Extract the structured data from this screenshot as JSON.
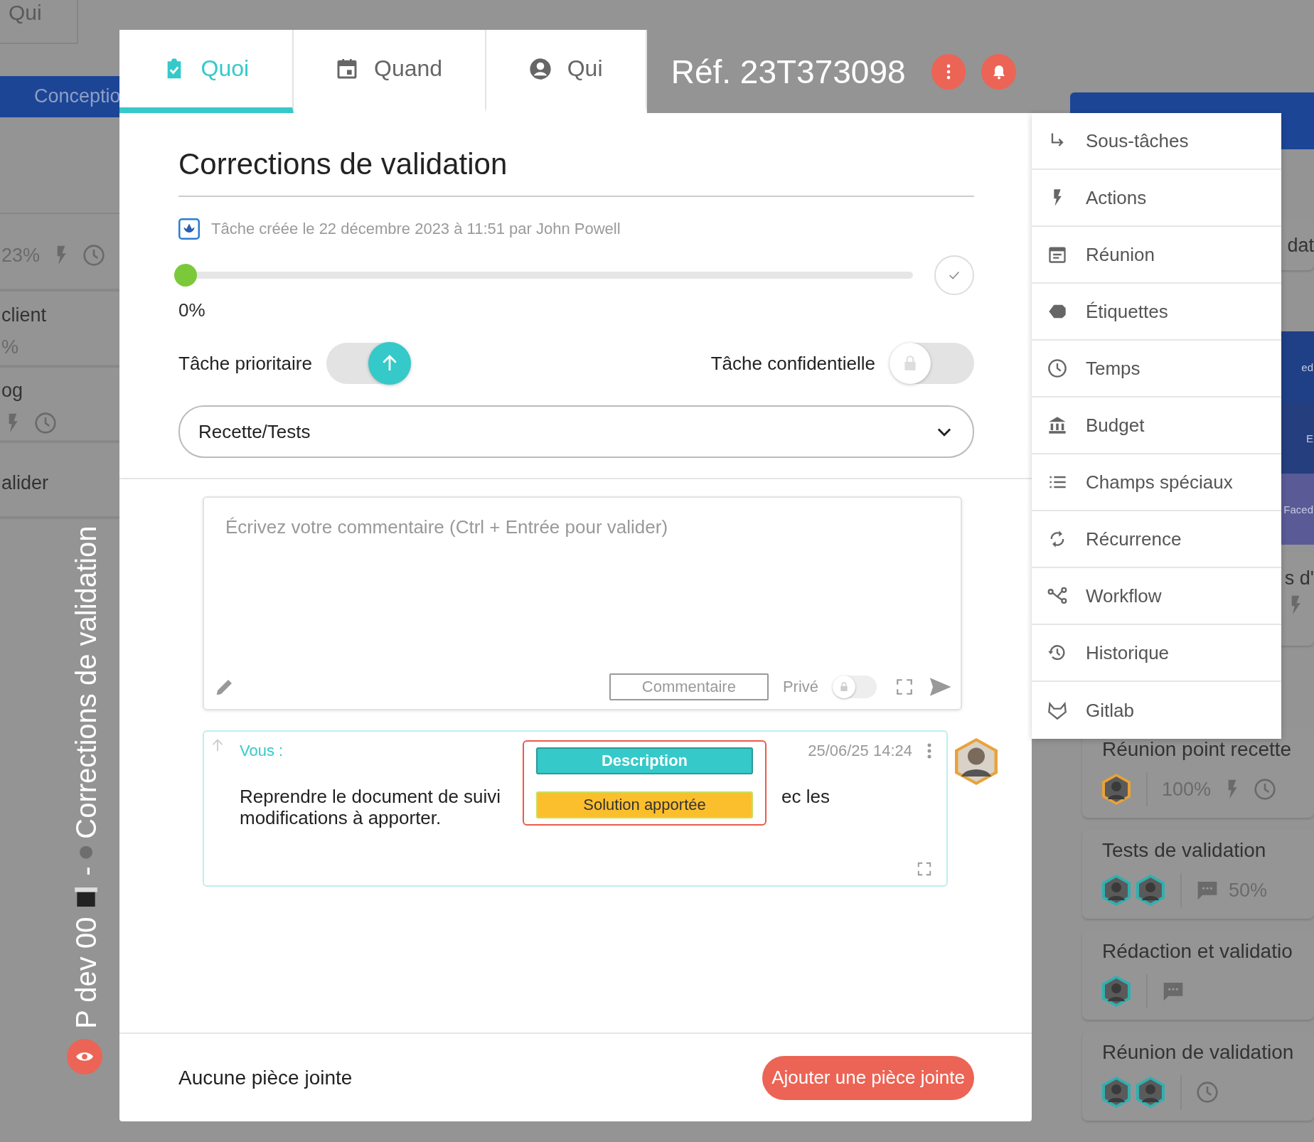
{
  "board": {
    "left_column": {
      "header": "Qui",
      "bar": "Conceptio",
      "cards": [
        {
          "items": [
            {
              "kind": "reading",
              "text": "23%"
            },
            {
              "kind": "bolt"
            },
            {
              "kind": "clock"
            }
          ]
        },
        {
          "title": "client",
          "items": [
            {
              "kind": "reading",
              "text": "%"
            }
          ]
        },
        {
          "title": "og",
          "items": [
            {
              "kind": "bolt"
            },
            {
              "kind": "clock"
            }
          ]
        },
        {
          "title": "alider"
        }
      ],
      "vertical_label": {
        "project": "P dev 00",
        "separator": "-",
        "task": "Corrections de validation"
      }
    },
    "right_column": {
      "top_card": "dat",
      "tiles": [
        {
          "text": "ed",
          "color": "#1f3f86"
        },
        {
          "text": "E",
          "color": "#243e7e"
        },
        {
          "text": "Faced",
          "color": "#5a5a96"
        }
      ],
      "partial_card": "s d'",
      "cards": [
        {
          "title": "Réunion point recette",
          "avatars": [
            {
              "color": "#e8a33a"
            }
          ],
          "items": [
            {
              "kind": "reading",
              "text": "100%"
            },
            {
              "kind": "bolt"
            },
            {
              "kind": "clock"
            }
          ]
        },
        {
          "title": "Tests de validation",
          "avatars": [
            {
              "color": "#2fb0b0"
            },
            {
              "color": "#2fb0b0"
            }
          ],
          "items": [
            {
              "kind": "comment"
            },
            {
              "kind": "reading",
              "text": "50%"
            }
          ]
        },
        {
          "title": "Rédaction et validatio",
          "avatars": [
            {
              "color": "#2fb0b0"
            }
          ],
          "items": [
            {
              "kind": "comment"
            }
          ]
        },
        {
          "title": "Réunion de validation",
          "avatars": [
            {
              "color": "#2fb0b0"
            },
            {
              "color": "#2fb0b0"
            }
          ],
          "items": [
            {
              "kind": "clock"
            }
          ]
        }
      ]
    }
  },
  "tabs": [
    {
      "label": "Quoi",
      "selected": true
    },
    {
      "label": "Quand",
      "selected": false
    },
    {
      "label": "Qui",
      "selected": false
    }
  ],
  "reference": "Réf. 23T373098",
  "task": {
    "title": "Corrections de validation",
    "meta": "Tâche créée le 22 décembre 2023 à 11:51 par John Powell",
    "progress": {
      "level": 0,
      "reading": "0%",
      "completed": false
    },
    "priority": {
      "label": "Tâche prioritaire",
      "on": true
    },
    "confidential": {
      "label": "Tâche confidentielle",
      "on": false
    },
    "status": {
      "value": "Recette/Tests"
    }
  },
  "comment_form": {
    "placeholder": "Écrivez votre commentaire (Ctrl + Entrée pour valider)",
    "type_button": "Commentaire",
    "private": {
      "label": "Privé",
      "on": false
    }
  },
  "comments": [
    {
      "author": "Vous :",
      "line1_start": "Reprendre le document de suivi",
      "line1_end": "ec les",
      "line2": "modifications à apporter.",
      "date": "25/06/25 14:24",
      "popup": [
        {
          "label": "Description",
          "color": "#35c9c9"
        },
        {
          "label": "Solution apportée",
          "color": "#fbbf2d"
        }
      ]
    }
  ],
  "attachments": {
    "empty_label": "Aucune pièce jointe",
    "add_button": "Ajouter une pièce jointe"
  },
  "side_menu": [
    {
      "label": "Sous-tâches"
    },
    {
      "label": "Actions"
    },
    {
      "label": "Réunion"
    },
    {
      "label": "Étiquettes"
    },
    {
      "label": "Temps"
    },
    {
      "label": "Budget"
    },
    {
      "label": "Champs spéciaux"
    },
    {
      "label": "Récurrence"
    },
    {
      "label": "Workflow"
    },
    {
      "label": "Historique"
    },
    {
      "label": "Gitlab"
    }
  ]
}
